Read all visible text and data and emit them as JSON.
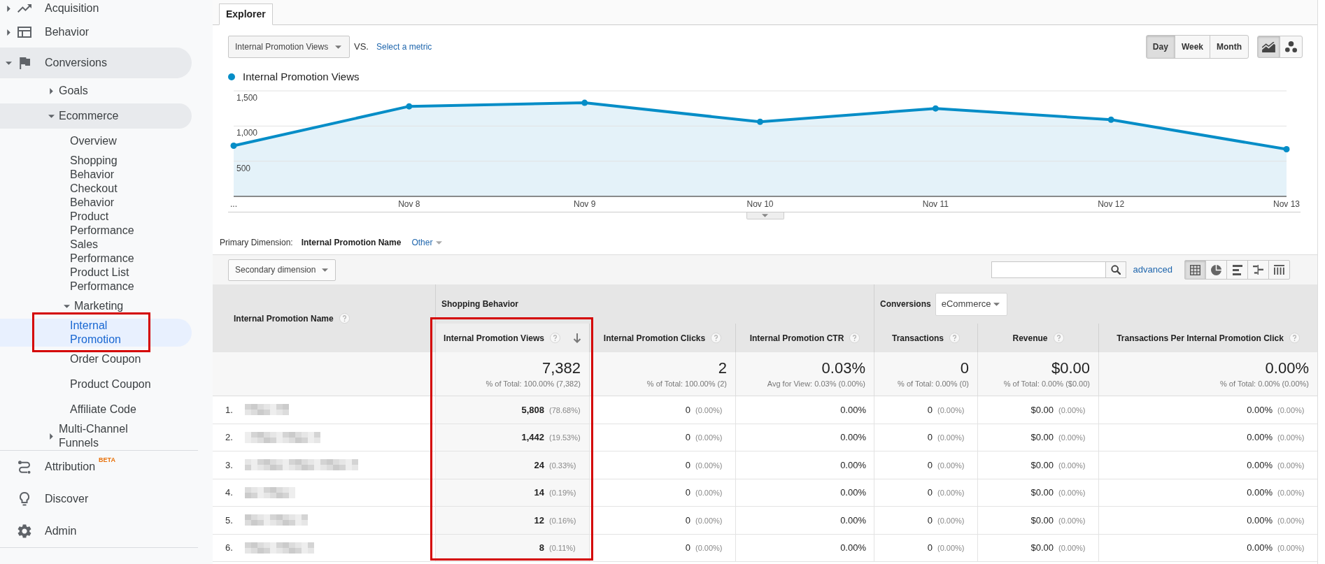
{
  "sidebar": {
    "items": [
      {
        "label": "Acquisition",
        "expanded": false,
        "highlighted": false,
        "selected": false
      },
      {
        "label": "Behavior",
        "expanded": false,
        "highlighted": false,
        "selected": false
      },
      {
        "label": "Conversions",
        "expanded": true,
        "highlighted": true,
        "selected": false,
        "children": [
          {
            "label": "Goals",
            "expanded": false,
            "highlighted": false,
            "selected": false
          },
          {
            "label": "Ecommerce",
            "expanded": true,
            "highlighted": true,
            "selected": false,
            "children": [
              {
                "label": "Overview",
                "selected": false
              },
              {
                "label": "Shopping Behavior",
                "selected": false
              },
              {
                "label": "Checkout Behavior",
                "selected": false
              },
              {
                "label": "Product Performance",
                "selected": false
              },
              {
                "label": "Sales Performance",
                "selected": false
              },
              {
                "label": "Product List Performance",
                "selected": false
              },
              {
                "label": "Marketing",
                "expanded": true,
                "highlighted": false,
                "selected": false,
                "children": [
                  {
                    "label": "Internal Promotion",
                    "selected": true,
                    "framed": true
                  },
                  {
                    "label": "Order Coupon",
                    "selected": false
                  },
                  {
                    "label": "Product Coupon",
                    "selected": false
                  },
                  {
                    "label": "Affiliate Code",
                    "selected": false
                  }
                ]
              }
            ]
          },
          {
            "label": "Multi-Channel Funnels",
            "expanded": false,
            "highlighted": false,
            "selected": false
          }
        ]
      }
    ],
    "footer_items": [
      {
        "label": "Attribution",
        "badge": "BETA",
        "selected": false
      },
      {
        "label": "Discover",
        "selected": false
      },
      {
        "label": "Admin",
        "selected": false
      }
    ]
  },
  "explorer": {
    "tabs": [
      {
        "label": "Explorer",
        "selected": true
      }
    ],
    "metric_select": {
      "value": "Internal Promotion Views"
    },
    "vs_label": "VS.",
    "compare_link": "Select a metric",
    "period_buttons": [
      {
        "label": "Day",
        "selected": true
      },
      {
        "label": "Week",
        "selected": false
      },
      {
        "label": "Month",
        "selected": false
      }
    ],
    "chart_type_buttons": [
      {
        "selected": true
      },
      {
        "selected": false
      }
    ],
    "chart_data": {
      "type": "area",
      "categories": [
        "...",
        "Nov 8",
        "Nov 9",
        "Nov 10",
        "Nov 11",
        "Nov 12",
        "Nov 13"
      ],
      "series": [
        {
          "name": "Internal Promotion Views",
          "color": "#058dc7",
          "values": [
            720,
            1280,
            1330,
            1060,
            1250,
            1090,
            670
          ]
        }
      ],
      "ylim": [
        0,
        1500
      ],
      "yticks": [
        {
          "value": 500,
          "label": "500"
        },
        {
          "value": 1000,
          "label": "1,000"
        },
        {
          "value": 1500,
          "label": "1,500"
        }
      ]
    }
  },
  "report": {
    "dimension_bar": {
      "label": "Primary Dimension:",
      "value": "Internal Promotion Name",
      "other_link": "Other"
    },
    "toolbar": {
      "secondary_dimension": {
        "label": "Secondary dimension"
      },
      "advanced_link": "advanced",
      "view_buttons": [
        {
          "selected": true
        },
        {
          "selected": false
        },
        {
          "selected": false
        },
        {
          "selected": false
        },
        {
          "selected": false
        }
      ]
    },
    "table": {
      "first_column": {
        "label": "Internal Promotion Name"
      },
      "groups": [
        {
          "label": "Shopping Behavior",
          "columns": [
            {
              "label": "Internal Promotion Views",
              "sorted": true,
              "framed": true
            },
            {
              "label": "Internal Promotion Clicks",
              "sorted": false
            },
            {
              "label": "Internal Promotion CTR",
              "sorted": false
            }
          ]
        },
        {
          "label": "Conversions",
          "select": "eCommerce",
          "columns": [
            {
              "label": "Transactions",
              "sorted": false
            },
            {
              "label": "Revenue",
              "sorted": false
            },
            {
              "label": "Transactions Per Internal Promotion Click",
              "sorted": false
            }
          ]
        }
      ],
      "totals": [
        {
          "value": "7,382",
          "note": "% of Total: 100.00% (7,382)"
        },
        {
          "value": "2",
          "note": "% of Total: 100.00% (2)"
        },
        {
          "value": "0.03%",
          "note": "Avg for View: 0.03% (0.00%)"
        },
        {
          "value": "0",
          "note": "% of Total: 0.00% (0)"
        },
        {
          "value": "$0.00",
          "note": "% of Total: 0.00% ($0.00)"
        },
        {
          "value": "0.00%",
          "note": "% of Total: 0.00% (0.00%)"
        }
      ],
      "rows": [
        {
          "index": "1.",
          "cells": [
            {
              "value": "5,808",
              "share": "(78.68%)"
            },
            {
              "value": "0",
              "share": "(0.00%)"
            },
            {
              "value": "0.00%"
            },
            {
              "value": "0",
              "share": "(0.00%)"
            },
            {
              "value": "$0.00",
              "share": "(0.00%)"
            },
            {
              "value": "0.00%",
              "share": "(0.00%)"
            }
          ]
        },
        {
          "index": "2.",
          "cells": [
            {
              "value": "1,442",
              "share": "(19.53%)"
            },
            {
              "value": "0",
              "share": "(0.00%)"
            },
            {
              "value": "0.00%"
            },
            {
              "value": "0",
              "share": "(0.00%)"
            },
            {
              "value": "$0.00",
              "share": "(0.00%)"
            },
            {
              "value": "0.00%",
              "share": "(0.00%)"
            }
          ]
        },
        {
          "index": "3.",
          "cells": [
            {
              "value": "24",
              "share": "(0.33%)"
            },
            {
              "value": "0",
              "share": "(0.00%)"
            },
            {
              "value": "0.00%"
            },
            {
              "value": "0",
              "share": "(0.00%)"
            },
            {
              "value": "$0.00",
              "share": "(0.00%)"
            },
            {
              "value": "0.00%",
              "share": "(0.00%)"
            }
          ]
        },
        {
          "index": "4.",
          "cells": [
            {
              "value": "14",
              "share": "(0.19%)"
            },
            {
              "value": "0",
              "share": "(0.00%)"
            },
            {
              "value": "0.00%"
            },
            {
              "value": "0",
              "share": "(0.00%)"
            },
            {
              "value": "$0.00",
              "share": "(0.00%)"
            },
            {
              "value": "0.00%",
              "share": "(0.00%)"
            }
          ]
        },
        {
          "index": "5.",
          "cells": [
            {
              "value": "12",
              "share": "(0.16%)"
            },
            {
              "value": "0",
              "share": "(0.00%)"
            },
            {
              "value": "0.00%"
            },
            {
              "value": "0",
              "share": "(0.00%)"
            },
            {
              "value": "$0.00",
              "share": "(0.00%)"
            },
            {
              "value": "0.00%",
              "share": "(0.00%)"
            }
          ]
        },
        {
          "index": "6.",
          "cells": [
            {
              "value": "8",
              "share": "(0.11%)"
            },
            {
              "value": "0",
              "share": "(0.00%)"
            },
            {
              "value": "0.00%"
            },
            {
              "value": "0",
              "share": "(0.00%)"
            },
            {
              "value": "$0.00",
              "share": "(0.00%)"
            },
            {
              "value": "0.00%",
              "share": "(0.00%)"
            }
          ]
        }
      ]
    }
  }
}
